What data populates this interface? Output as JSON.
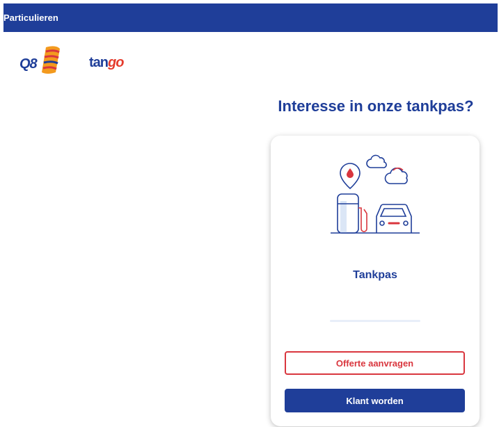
{
  "header": {
    "tab_label": "Particulieren"
  },
  "logos": {
    "q8_text": "Q8",
    "tango_prefix": "tan",
    "tango_suffix": "go"
  },
  "main": {
    "headline": "Interesse in onze tankpas?",
    "card": {
      "title": "Tankpas",
      "illustration_icon": "fuel-station-car-icon",
      "quote_button_label": "Offerte aanvragen",
      "customer_button_label": "Klant worden"
    }
  },
  "colors": {
    "brand_blue": "#1f3e99",
    "accent_red": "#d9363e"
  }
}
